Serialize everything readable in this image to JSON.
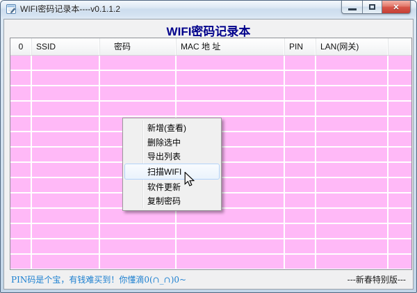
{
  "window": {
    "title": "WIFI密码记录本----v0.1.1.2"
  },
  "page_header": {
    "title": "WIFI密码记录本"
  },
  "table": {
    "columns": [
      "0",
      "SSID",
      "密码",
      "MAC 地 址",
      "PIN",
      "LAN(网关)",
      ""
    ],
    "row_count": 14,
    "rows": []
  },
  "context_menu": {
    "items": [
      {
        "label": "新增(查看)",
        "highlighted": false
      },
      {
        "label": "删除选中",
        "highlighted": false
      },
      {
        "label": "导出列表",
        "highlighted": false
      },
      {
        "label": "扫描WIFI",
        "highlighted": true
      },
      {
        "label": "软件更新",
        "highlighted": false
      },
      {
        "label": "复制密码",
        "highlighted": false
      }
    ]
  },
  "status_bar": {
    "left_text": "PIN码是个宝，有钱难买到！你懂滴0(∩_∩)0~",
    "right_text": "---新春特别版---"
  },
  "colors": {
    "row-pink": "#ffb9f7",
    "title-navy": "#00008b",
    "status-blue": "#1b7fd0",
    "close-red": "#d8574a"
  }
}
